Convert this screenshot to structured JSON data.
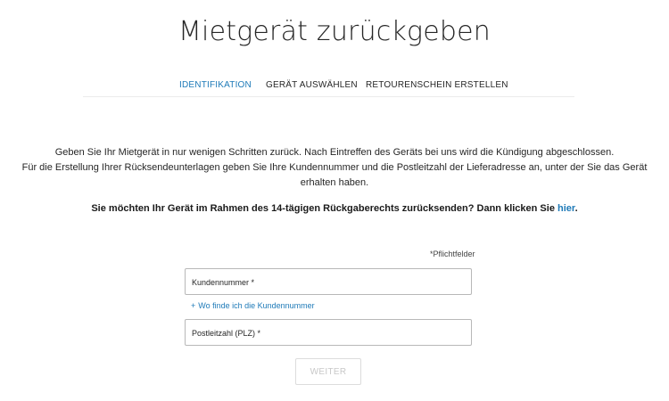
{
  "page": {
    "title": "Mietgerät zurückgeben"
  },
  "steps": [
    {
      "label": "IDENTIFIKATION",
      "active": true
    },
    {
      "label": "GERÄT AUSWÄHLEN",
      "active": false
    },
    {
      "label": "RETOURENSCHEIN ERSTELLEN",
      "active": false
    }
  ],
  "intro": {
    "line1": "Geben Sie Ihr Mietgerät in nur wenigen Schritten zurück. Nach Eintreffen des Geräts bei uns wird die Kündigung abgeschlossen.",
    "line2": "Für die Erstellung Ihrer Rücksendeunterlagen geben Sie Ihre Kundennummer und die Postleitzahl der Lieferadresse an, unter der Sie das Gerät",
    "line3": "erhalten haben."
  },
  "rueckgabe": {
    "text": "Sie möchten Ihr Gerät im Rahmen des 14-tägigen Rückgaberechts zurücksenden? Dann klicken Sie ",
    "link": "hier",
    "end": "."
  },
  "form": {
    "required_note": "*Pflichtfelder",
    "customer_number_label": "Kundennummer *",
    "customer_number_value": "",
    "help_link_plus": "+",
    "help_link_text": "Wo finde ich die Kundennummer",
    "postcode_label": "Postleitzahl (PLZ) *",
    "postcode_value": "",
    "submit_label": "WEITER"
  },
  "colors": {
    "accent": "#1e7ab8",
    "text": "#262626",
    "border": "#b8b8b8",
    "disabled": "#c8c8c8"
  }
}
